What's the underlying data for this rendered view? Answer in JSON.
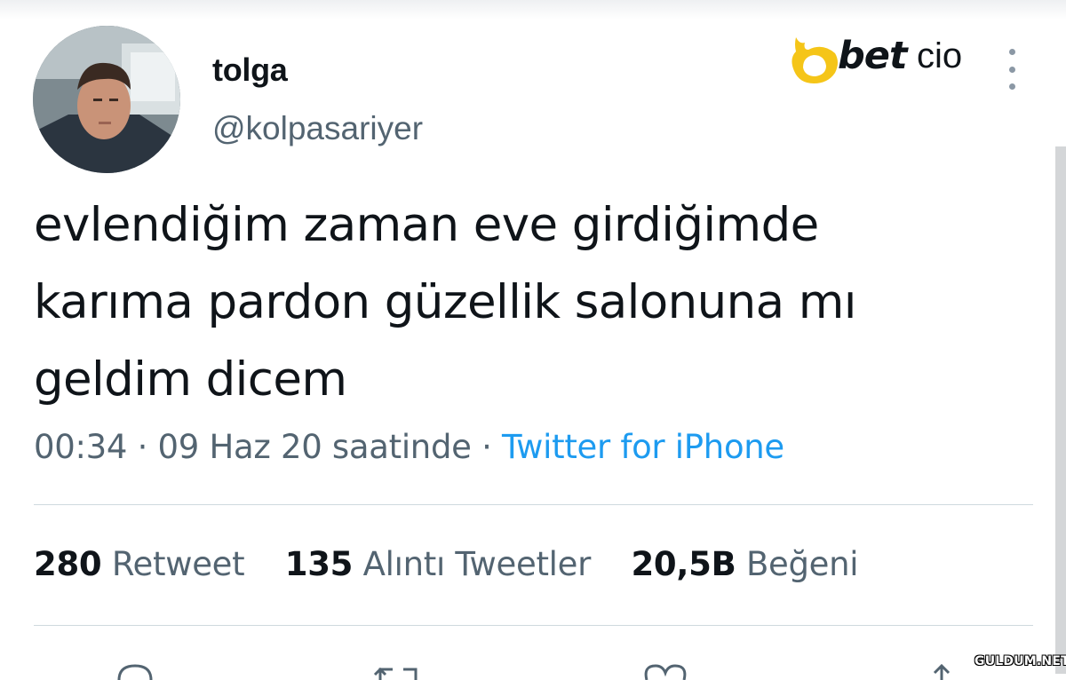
{
  "tweet": {
    "author": {
      "display_name": "tolga",
      "handle": "@kolpasariyer"
    },
    "text": "evlendiğim zaman eve girdiğimde\nkarıma pardon güzellik salonuna mı\ngeldim dicem",
    "time": "00:34",
    "date": "09 Haz 20 saatinde",
    "separator": " · ",
    "source": "Twitter for iPhone",
    "stats": [
      {
        "count": "280",
        "label": "Retweet"
      },
      {
        "count": "135",
        "label": "Alıntı Tweetler"
      },
      {
        "count": "20,5B",
        "label": "Beğeni"
      }
    ],
    "actions": [
      "reply-icon",
      "retweet-icon",
      "like-icon",
      "share-icon"
    ]
  },
  "brand": {
    "name": "betcio",
    "part1": "bet",
    "part2": "cio",
    "accent": "#f5c518"
  },
  "watermark": "GULDUM.NET",
  "colors": {
    "text": "#0f1419",
    "secondary": "#536471",
    "link": "#1d9bf0",
    "divider": "#cfd9de"
  },
  "icons": {
    "more": "more-vertical-icon"
  }
}
